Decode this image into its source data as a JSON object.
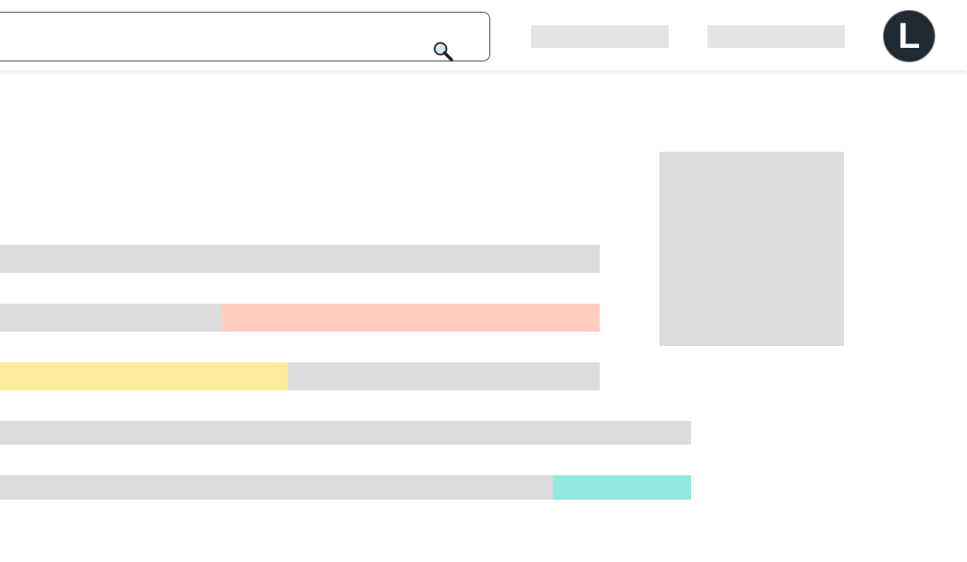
{
  "header": {
    "search": {
      "value": "",
      "placeholder": "",
      "icon": "search-icon"
    },
    "avatar": {
      "initial": "L",
      "color": "#1f2a35"
    }
  },
  "content": {
    "bars": [
      {
        "highlight": null
      },
      {
        "highlight": {
          "color": "#ffcdc0",
          "start_fraction": 0.37,
          "end_fraction": 1.0
        }
      },
      {
        "highlight": {
          "color": "#ffe99d",
          "start_fraction": 0.0,
          "end_fraction": 0.48
        }
      },
      {
        "highlight": null
      },
      {
        "highlight": {
          "color": "#93e8e0",
          "start_fraction": 0.8,
          "end_fraction": 1.0
        }
      }
    ],
    "placeholder_color": "#dcdcdc"
  }
}
